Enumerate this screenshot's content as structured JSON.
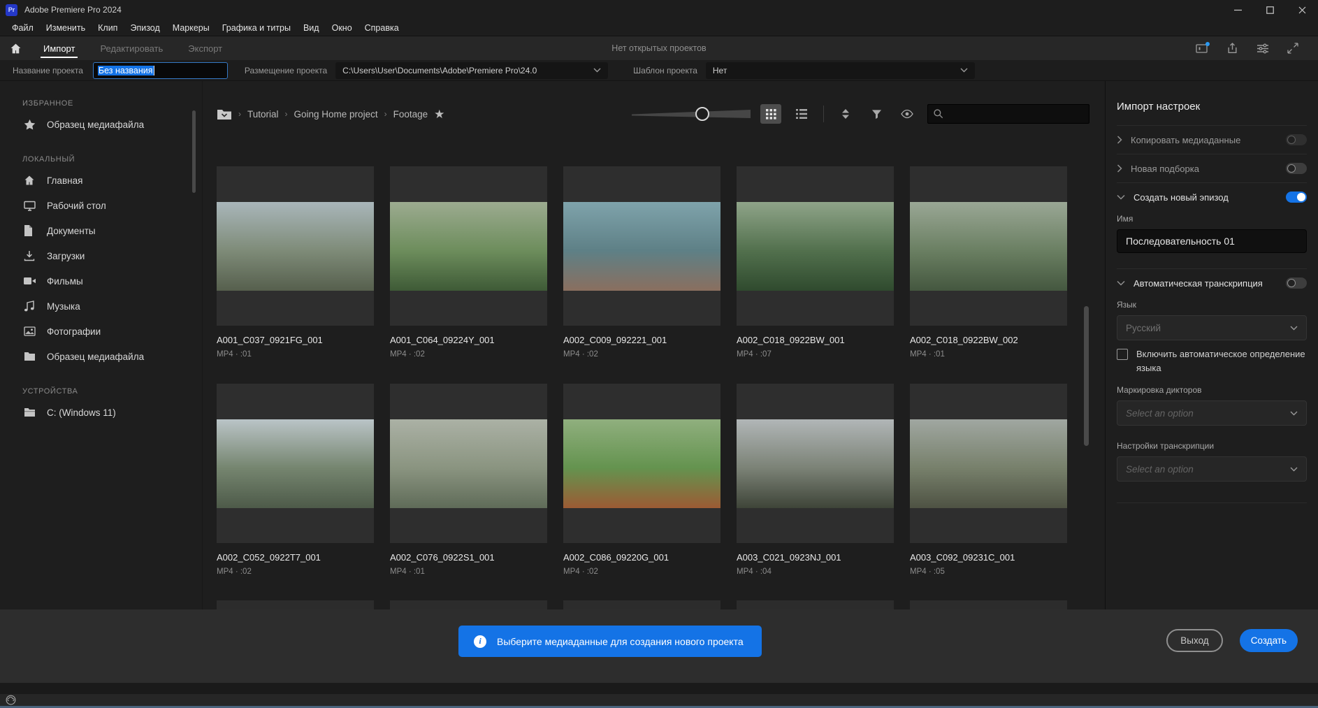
{
  "titlebar": {
    "logo_text": "Pr",
    "app_title": "Adobe Premiere Pro 2024"
  },
  "menu": {
    "items": [
      "Файл",
      "Изменить",
      "Клип",
      "Эпизод",
      "Маркеры",
      "Графика и титры",
      "Вид",
      "Окно",
      "Справка"
    ]
  },
  "header": {
    "tabs": [
      {
        "label": "Импорт",
        "active": true
      },
      {
        "label": "Редактировать",
        "active": false
      },
      {
        "label": "Экспорт",
        "active": false
      }
    ],
    "status": "Нет открытых проектов",
    "action_icons": [
      "workspace",
      "share",
      "settings",
      "fullscreen"
    ]
  },
  "project_row": {
    "name_label": "Название проекта",
    "name_value": "Без названия",
    "location_label": "Размещение проекта",
    "location_value": "C:\\Users\\User\\Documents\\Adobe\\Premiere Pro\\24.0",
    "template_label": "Шаблон проекта",
    "template_value": "Нет"
  },
  "sidebar": {
    "sections": [
      {
        "title": "ИЗБРАННОЕ",
        "items": [
          {
            "icon": "star",
            "label": "Образец медиафайла"
          }
        ]
      },
      {
        "title": "ЛОКАЛЬНЫЙ",
        "items": [
          {
            "icon": "home",
            "label": "Главная"
          },
          {
            "icon": "monitor",
            "label": "Рабочий стол"
          },
          {
            "icon": "document",
            "label": "Документы"
          },
          {
            "icon": "download",
            "label": "Загрузки"
          },
          {
            "icon": "film",
            "label": "Фильмы"
          },
          {
            "icon": "music",
            "label": "Музыка"
          },
          {
            "icon": "photo",
            "label": "Фотографии"
          },
          {
            "icon": "folder",
            "label": "Образец медиафайла"
          }
        ]
      },
      {
        "title": "УСТРОЙСТВА",
        "items": [
          {
            "icon": "drive",
            "label": "C: (Windows 11)"
          }
        ]
      }
    ]
  },
  "browser": {
    "breadcrumb": [
      "Tutorial",
      "Going Home project",
      "Footage"
    ],
    "toolbar_icons": [
      "zoom-slider",
      "grid-view",
      "list-view",
      "sort",
      "filter",
      "preview-eye",
      "search"
    ],
    "search_value": "",
    "media": [
      {
        "name": "A001_C037_0921FG_001",
        "meta": "MP4 · :01",
        "thumb": [
          "#a9b6ba",
          "#7e8b78",
          "#565f4d"
        ]
      },
      {
        "name": "A001_C064_09224Y_001",
        "meta": "MP4 · :02",
        "thumb": [
          "#9cab90",
          "#6d8d5c",
          "#3e5a36"
        ]
      },
      {
        "name": "A002_C009_092221_001",
        "meta": "MP4 · :02",
        "thumb": [
          "#7fa3ab",
          "#5e8086",
          "#8a6f5f"
        ]
      },
      {
        "name": "A002_C018_0922BW_001",
        "meta": "MP4 · :07",
        "thumb": [
          "#8fa489",
          "#52704d",
          "#2f4a2e"
        ]
      },
      {
        "name": "A002_C018_0922BW_002",
        "meta": "MP4 · :01",
        "thumb": [
          "#9aa795",
          "#6a7f62",
          "#44573f"
        ]
      },
      {
        "name": "A002_C052_0922T7_001",
        "meta": "MP4 · :02",
        "thumb": [
          "#bac4c7",
          "#75856f",
          "#4d5a49"
        ]
      },
      {
        "name": "A002_C076_0922S1_001",
        "meta": "MP4 · :01",
        "thumb": [
          "#abb1a5",
          "#8a9480",
          "#5f6b58"
        ]
      },
      {
        "name": "A002_C086_09220G_001",
        "meta": "MP4 · :02",
        "thumb": [
          "#90af7e",
          "#64934f",
          "#9c5b34"
        ]
      },
      {
        "name": "A003_C021_0923NJ_001",
        "meta": "MP4 · :04",
        "thumb": [
          "#b1b6b7",
          "#7b8276",
          "#3e4438"
        ]
      },
      {
        "name": "A003_C092_09231C_001",
        "meta": "MP4 · :05",
        "thumb": [
          "#a0a7a1",
          "#77806b",
          "#4e5243"
        ]
      }
    ]
  },
  "import_settings": {
    "title": "Импорт настроек",
    "copy_media": {
      "label": "Копировать медиаданные",
      "enabled": false
    },
    "new_bin": {
      "label": "Новая подборка",
      "enabled": false
    },
    "create_sequence": {
      "label": "Создать новый эпизод",
      "enabled": true,
      "name_label": "Имя",
      "name_value": "Последовательность 01"
    },
    "transcription": {
      "label": "Автоматическая транскрипция",
      "enabled": false,
      "language_label": "Язык",
      "language_value": "Русский",
      "auto_detect_label": "Включить автоматическое определение языка",
      "speakers_label": "Маркировка дикторов",
      "speakers_value": "Select an option",
      "settings_label": "Настройки транскрипции",
      "settings_value": "Select an option"
    }
  },
  "footer": {
    "banner_text": "Выберите медиаданные для создания нового проекта",
    "exit_label": "Выход",
    "create_label": "Создать"
  },
  "colors": {
    "accent": "#1473e6",
    "banner": "#1473e6",
    "toggle_on": "#1473e6",
    "selection": "#1473e6"
  }
}
